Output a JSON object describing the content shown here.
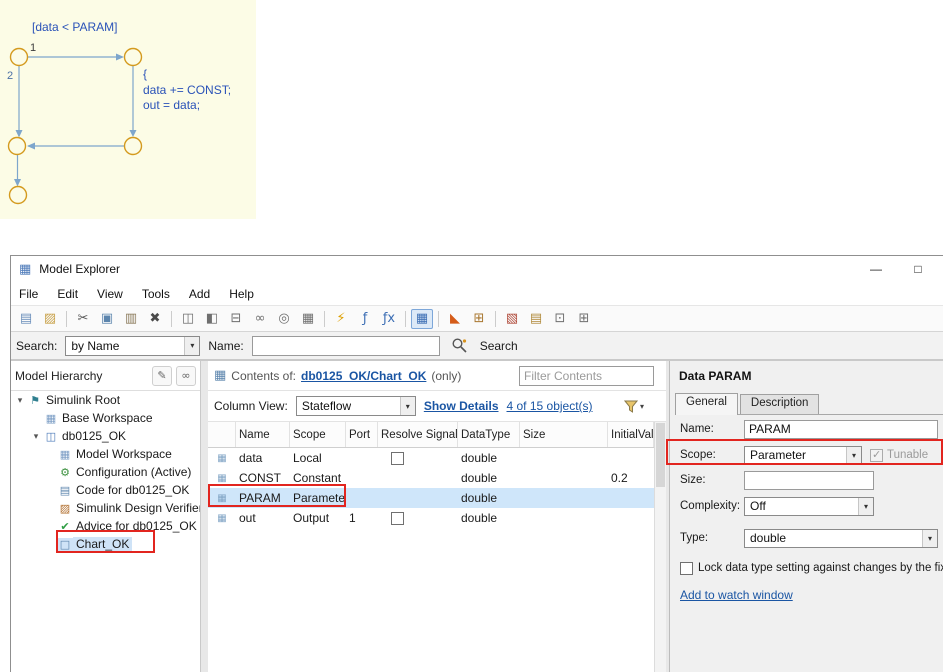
{
  "colors": {
    "annotation": "#e2251f",
    "selection": "#cfe6fa",
    "link": "#1a55a3"
  },
  "icons": {
    "chevron": "▾",
    "pencil": "✎",
    "binocular": "∞",
    "app": "▦",
    "contents": "▦",
    "grid": "▦",
    "minimize": "—",
    "maximize": "□"
  },
  "chart": {
    "condition": "[data < PARAM]",
    "label_1": "1",
    "label_2": "2",
    "action_open": "{",
    "action_line1": "data += CONST;",
    "action_line2": "out = data;"
  },
  "window": {
    "title": "Model Explorer",
    "menu": [
      "File",
      "Edit",
      "View",
      "Tools",
      "Add",
      "Help"
    ],
    "toolbar": [
      {
        "name": "new-model-icon",
        "glyph": "▤",
        "color": "#6b8fbb"
      },
      {
        "name": "open-model-icon",
        "glyph": "▨",
        "color": "#c9a24a"
      },
      {
        "sep": true
      },
      {
        "name": "cut-icon",
        "glyph": "✂",
        "color": "#555555"
      },
      {
        "name": "copy-icon",
        "glyph": "▣",
        "color": "#5c85ad"
      },
      {
        "name": "paste-icon",
        "glyph": "▥",
        "color": "#8a7a5a"
      },
      {
        "name": "delete-icon",
        "glyph": "✖",
        "color": "#4a4a4a"
      },
      {
        "sep": true
      },
      {
        "name": "model-browser-pane-icon",
        "glyph": "◫",
        "color": "#6f6f6f"
      },
      {
        "name": "dialog-pane-icon",
        "glyph": "◧",
        "color": "#6f6f6f"
      },
      {
        "name": "search-results-pane-icon",
        "glyph": "⊟",
        "color": "#6f6f6f"
      },
      {
        "name": "link-icon",
        "glyph": "∞",
        "color": "#6f6f6f"
      },
      {
        "name": "compare-icon",
        "glyph": "◎",
        "color": "#6f6f6f"
      },
      {
        "name": "grid-view-icon",
        "glyph": "▦",
        "color": "#6f6f6f"
      },
      {
        "sep": true
      },
      {
        "name": "add-event-icon",
        "glyph": "⚡",
        "color": "#dd9f00"
      },
      {
        "name": "add-data-icon",
        "glyph": "ƒ",
        "color": "#3c6eb4"
      },
      {
        "name": "add-function-icon",
        "glyph": "ƒx",
        "color": "#3c6eb4"
      },
      {
        "sep": true
      },
      {
        "name": "column-view-icon",
        "glyph": "▦",
        "color": "#3c6eb4",
        "pressed": true
      },
      {
        "sep": true
      },
      {
        "name": "matlab-arrow-icon",
        "glyph": "◣",
        "color": "#d55c19"
      },
      {
        "name": "layout-options-icon",
        "glyph": "⊞",
        "color": "#a8762e"
      },
      {
        "sep": true
      },
      {
        "name": "highlight-block-icon",
        "glyph": "▧",
        "color": "#b04a3a"
      },
      {
        "name": "open-system-icon",
        "glyph": "▤",
        "color": "#b08a3a"
      },
      {
        "name": "copy-config-icon",
        "glyph": "⊡",
        "color": "#6f6f6f"
      },
      {
        "name": "paste-config-icon",
        "glyph": "⊞",
        "color": "#6f6f6f"
      }
    ],
    "search": {
      "label": "Search:",
      "mode": "by Name",
      "name_label": "Name:",
      "name_value": "",
      "button": "Search"
    }
  },
  "hierarchy": {
    "title": "Model Hierarchy",
    "items": [
      {
        "label": "Simulink Root",
        "level": 0,
        "expand": true,
        "icon": "flag-icon",
        "glyph": "⚑",
        "color": "#2f7f8f"
      },
      {
        "label": "Base Workspace",
        "level": 1,
        "icon": "workspace-icon",
        "glyph": "▦",
        "color": "#7a9cc4"
      },
      {
        "label": "db0125_OK",
        "level": 1,
        "expand": true,
        "icon": "model-icon",
        "glyph": "◫",
        "color": "#4a78b8"
      },
      {
        "label": "Model Workspace",
        "level": 2,
        "icon": "workspace-icon",
        "glyph": "▦",
        "color": "#7a9cc4"
      },
      {
        "label": "Configuration (Active)",
        "level": 2,
        "icon": "gear-icon",
        "glyph": "⚙",
        "color": "#3d9140"
      },
      {
        "label": "Code for db0125_OK",
        "level": 2,
        "icon": "code-icon",
        "glyph": "▤",
        "color": "#5c85ad"
      },
      {
        "label": "Simulink Design Verifier",
        "level": 2,
        "icon": "verifier-icon",
        "glyph": "▨",
        "color": "#b06c2a"
      },
      {
        "label": "Advice for db0125_OK",
        "level": 2,
        "icon": "check-icon",
        "glyph": "✔",
        "color": "#2f9e44"
      },
      {
        "label": "Chart_OK",
        "level": 2,
        "selected": true,
        "icon": "chart-icon",
        "glyph": "□",
        "color": "#5c85ad"
      }
    ]
  },
  "contents": {
    "prefix": "Contents of:",
    "target": "db0125_OK/Chart_OK",
    "suffix": "(only)",
    "filter_placeholder": "Filter Contents",
    "column_view_label": "Column View:",
    "column_view": "Stateflow",
    "show_details": "Show Details",
    "objects": "4 of 15 object(s)",
    "columns": [
      "Name",
      "Scope",
      "Port",
      "Resolve Signal",
      "DataType",
      "Size",
      "InitialValu"
    ],
    "rows": [
      {
        "name": "data",
        "scope": "Local",
        "port": "",
        "resolve_box": true,
        "datatype": "double",
        "size": "",
        "initial": ""
      },
      {
        "name": "CONST",
        "scope": "Constant",
        "port": "",
        "datatype": "double",
        "size": "",
        "initial": "0.2"
      },
      {
        "name": "PARAM",
        "scope": "Parameter",
        "port": "",
        "datatype": "double",
        "size": "",
        "initial": "",
        "selected": true
      },
      {
        "name": "out",
        "scope": "Output",
        "port": "1",
        "resolve_box": true,
        "datatype": "double",
        "size": "",
        "initial": ""
      }
    ]
  },
  "dialog": {
    "title": "Data PARAM",
    "tab_general": "General",
    "tab_description": "Description",
    "name_label": "Name:",
    "name_value": "PARAM",
    "scope_label": "Scope:",
    "scope_value": "Parameter",
    "tunable": "Tunable",
    "size_label": "Size:",
    "complexity_label": "Complexity:",
    "complexity_value": "Off",
    "type_label": "Type:",
    "type_value": "double",
    "lock_label": "Lock data type setting against changes by the fixe",
    "watch_link": "Add to watch window"
  }
}
